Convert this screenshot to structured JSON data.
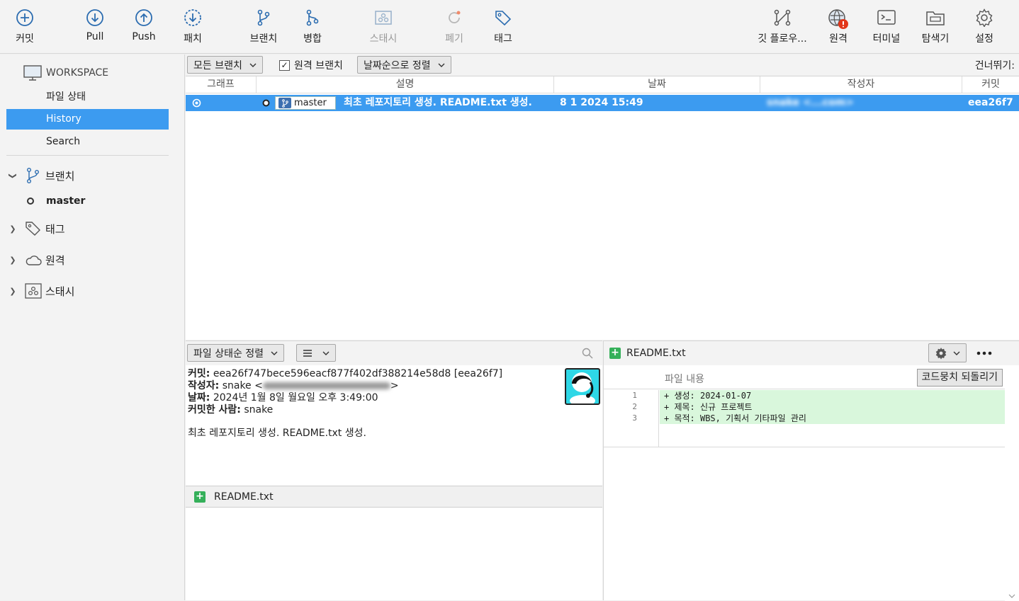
{
  "toolbar": {
    "commit": "커밋",
    "pull": "Pull",
    "push": "Push",
    "patch": "패치",
    "branch": "브랜치",
    "merge": "병합",
    "stash": "스태시",
    "discard": "폐기",
    "tag": "태그",
    "gitflow": "깃 플로우...",
    "remote": "원격",
    "terminal": "터미널",
    "explorer": "탐색기",
    "settings": "설정"
  },
  "sidebar": {
    "workspace": "WORKSPACE",
    "file_status": "파일 상태",
    "history": "History",
    "search": "Search",
    "branches": "브랜치",
    "current_branch": "master",
    "tags": "태그",
    "remotes": "원격",
    "stashes": "스태시"
  },
  "filter": {
    "branches": "모든 브랜치",
    "remote_branches": "원격 브랜치",
    "sort": "날짜순으로 정렬",
    "jump": "건너뛰기:"
  },
  "history": {
    "columns": {
      "graph": "그래프",
      "description": "설명",
      "date": "날짜",
      "author": "작성자",
      "commit": "커밋"
    },
    "rows": [
      {
        "branch": "master",
        "description": "최초 레포지토리 생성. README.txt 생성.",
        "date": "8 1 2024 15:49",
        "author": "snake <...com>",
        "commit": "eea26f7"
      }
    ]
  },
  "details": {
    "sort": "파일 상태순 정렬",
    "commit_label": "커밋:",
    "commit_value": "eea26f747bece596eacf877f402df388214e58d8 [eea26f7]",
    "author_label": "작성자:",
    "author_value": "snake <",
    "author_tail": ">",
    "date_label": "날짜:",
    "date_value": "2024년 1월 8일 월요일 오후 3:49:00",
    "committer_label": "커밋한 사람:",
    "committer_value": "snake",
    "message": "최초 레포지토리 생성. README.txt 생성.",
    "file": "README.txt"
  },
  "diff": {
    "file": "README.txt",
    "content_label": "파일 내용",
    "revert_button": "코드뭉치 되돌리기",
    "lines": [
      {
        "n": "1",
        "text": "+ 생성: 2024-01-07"
      },
      {
        "n": "2",
        "text": "+ 제목: 신규 프로젝트"
      },
      {
        "n": "3",
        "text": "+ 목적: WBS, 기획서 기타파일 관리"
      }
    ]
  },
  "colors": {
    "accent": "#3c9bf0",
    "added": "#d9f7dc",
    "alert": "#e2361a"
  }
}
